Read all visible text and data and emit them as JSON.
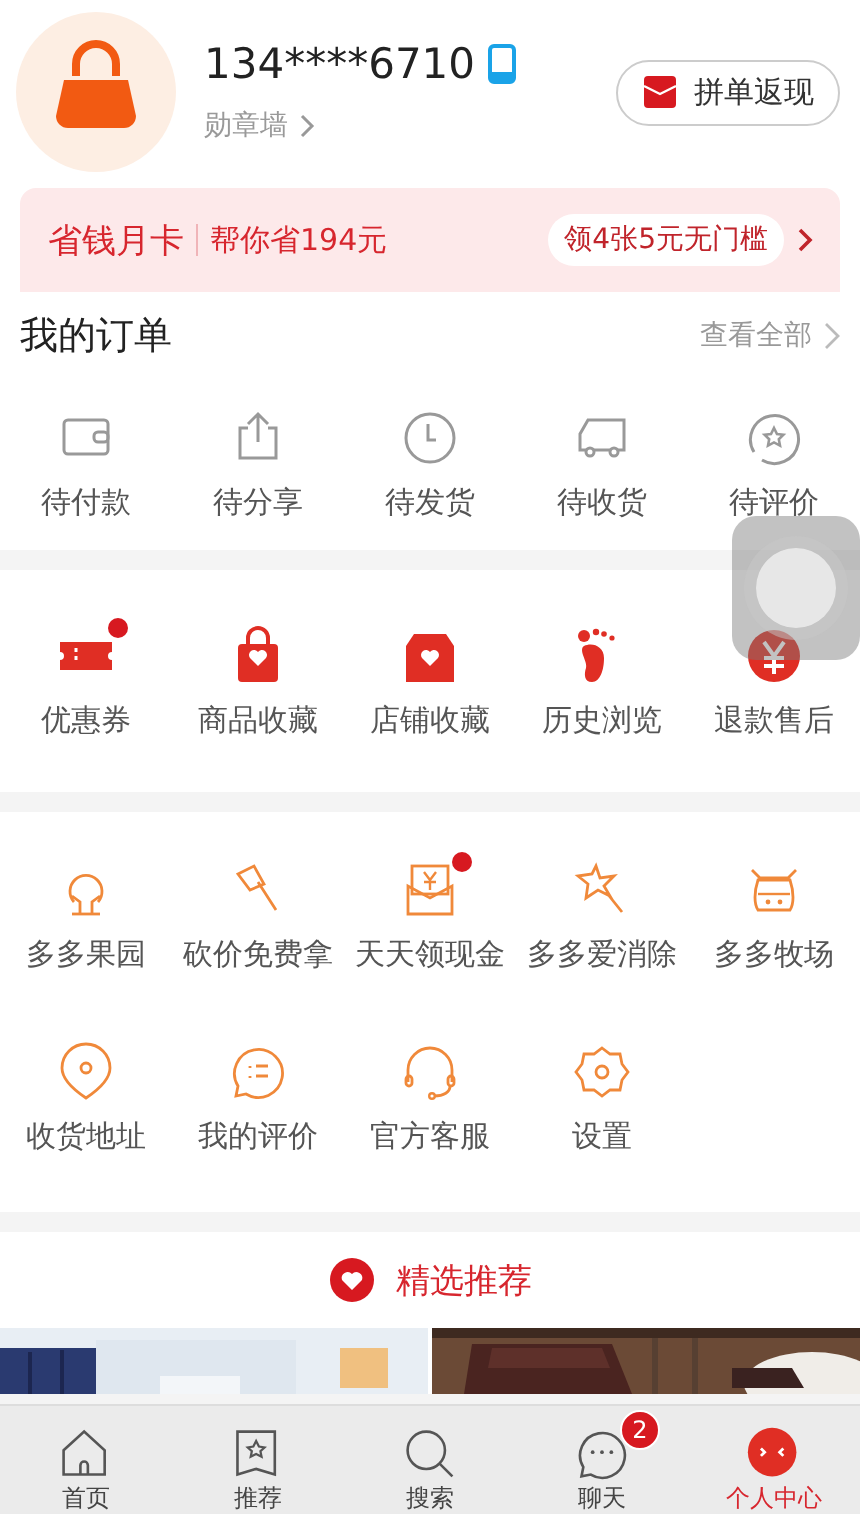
{
  "profile": {
    "phone": "134****6710",
    "badge_link": "勋章墙",
    "group_button": "拼单返现"
  },
  "month_card": {
    "title": "省钱月卡",
    "saving": "帮你省194元",
    "offer": "领4张5元无门槛"
  },
  "orders": {
    "title": "我的订单",
    "view_all": "查看全部",
    "items": [
      {
        "label": "待付款"
      },
      {
        "label": "待分享"
      },
      {
        "label": "待发货"
      },
      {
        "label": "待收货"
      },
      {
        "label": "待评价"
      }
    ]
  },
  "services": [
    {
      "label": "优惠券",
      "badge": true
    },
    {
      "label": "商品收藏",
      "badge": false
    },
    {
      "label": "店铺收藏",
      "badge": false
    },
    {
      "label": "历史浏览",
      "badge": false
    },
    {
      "label": "退款售后",
      "badge": false
    }
  ],
  "tools": [
    {
      "label": "多多果园",
      "badge": false
    },
    {
      "label": "砍价免费拿",
      "badge": false
    },
    {
      "label": "天天领现金",
      "badge": true
    },
    {
      "label": "多多爱消除",
      "badge": false
    },
    {
      "label": "多多牧场",
      "badge": false
    },
    {
      "label": "收货地址",
      "badge": false
    },
    {
      "label": "我的评价",
      "badge": false
    },
    {
      "label": "官方客服",
      "badge": false
    },
    {
      "label": "设置",
      "badge": false
    }
  ],
  "recommend": {
    "title": "精选推荐"
  },
  "tab_bar": [
    {
      "label": "首页",
      "selected": false
    },
    {
      "label": "推荐",
      "selected": false
    },
    {
      "label": "搜索",
      "selected": false
    },
    {
      "label": "聊天",
      "selected": false,
      "badge": "2"
    },
    {
      "label": "个人中心",
      "selected": true
    }
  ]
}
